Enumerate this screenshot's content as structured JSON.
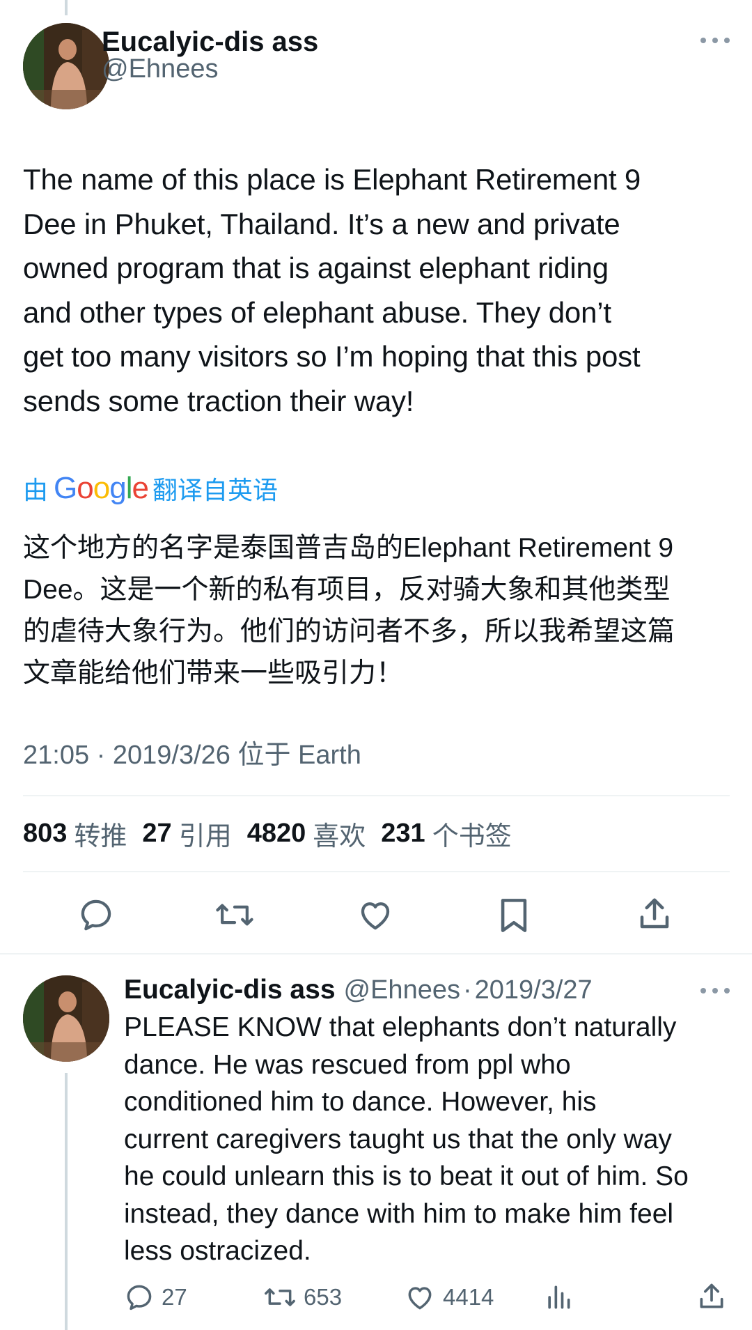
{
  "tweet": {
    "author_name": "Eucalyic-dis ass",
    "handle": "@Ehnees",
    "text": "The name of this place is Elephant Retirement 9\nDee in Phuket, Thailand. It’s a new and private\nowned program that is against elephant riding\nand other types of elephant abuse. They don’t\nget too many visitors so I’m hoping that this post\nsends some traction their way!",
    "translate_prefix": "由",
    "translate_brand": "Google",
    "translate_suffix": "翻译自英语",
    "translated_text": "这个地方的名字是泰国普吉岛的Elephant Retirement 9\nDee。这是一个新的私有项目，反对骑大象和其他类型\n的虐待大象行为。他们的访问者不多，所以我希望这篇\n文章能给他们带来一些吸引力！",
    "timestamp": "21:05 · 2019/3/26 位于 Earth",
    "stats": [
      {
        "num": "803",
        "label": "转推"
      },
      {
        "num": "27",
        "label": "引用"
      },
      {
        "num": "4820",
        "label": "喜欢"
      },
      {
        "num": "231",
        "label": "个书签"
      }
    ],
    "actions": [
      "reply-icon",
      "retweet-icon",
      "like-icon",
      "bookmark-icon",
      "share-icon"
    ]
  },
  "reply": {
    "author_name": "Eucalyic-dis ass",
    "handle": "@Ehnees",
    "separator": "·",
    "date": "2019/3/27",
    "text": "PLEASE KNOW that elephants don’t naturally\ndance. He was rescued from ppl who\nconditioned him to dance. However, his\ncurrent caregivers taught us that the only way\nhe could unlearn this is to beat it out of him. So\ninstead, they dance with him to make him feel\nless ostracized.",
    "reply_count": "27",
    "retweet_count": "653",
    "like_count": "4414"
  },
  "colors": {
    "accent": "#1d9bf0",
    "text": "#0f1419",
    "muted": "#536471",
    "divider": "#eff3f4"
  }
}
